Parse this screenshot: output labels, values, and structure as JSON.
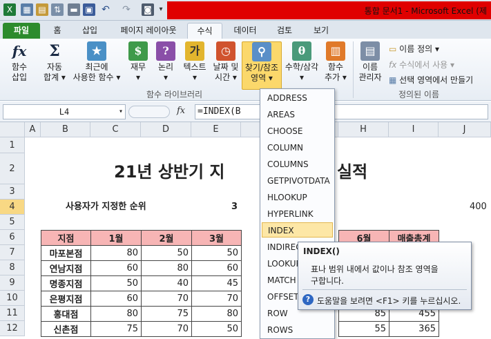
{
  "window": {
    "title": "통합 문서1 - Microsoft Excel (제"
  },
  "tabs": [
    "파일",
    "홈",
    "삽입",
    "페이지 레이아웃",
    "수식",
    "데이터",
    "검토",
    "보기"
  ],
  "ribbon": {
    "fx": {
      "symbol": "fx",
      "l1": "함수",
      "l2": "삽입"
    },
    "sum": {
      "symbol": "Σ",
      "l1": "자동",
      "l2": "합계 ▾"
    },
    "recent": {
      "l1": "최근에",
      "l2": "사용한 함수 ▾"
    },
    "finance": {
      "l1": "재무",
      "l2": "▾"
    },
    "logic": {
      "l1": "논리",
      "l2": "▾"
    },
    "text": {
      "l1": "텍스트",
      "l2": "▾"
    },
    "date": {
      "l1": "날짜 및",
      "l2": "시간 ▾"
    },
    "lookup": {
      "l1": "찾기/참조",
      "l2": "영역 ▾"
    },
    "math": {
      "l1": "수학/삼각",
      "l2": "▾"
    },
    "more": {
      "l1": "함수",
      "l2": "추가 ▾"
    },
    "group_library": "함수 라이브러리",
    "name_manager": {
      "l1": "이름",
      "l2": "관리자"
    },
    "define_name": "이름 정의 ▾",
    "use_in_formula": "수식에서 사용 ▾",
    "create_from_sel": "선택 영역에서 만들기",
    "group_names": "정의된 이름"
  },
  "formula_bar": {
    "name_box": "L4",
    "fx": "fx",
    "formula": "=INDEX(B"
  },
  "columns": [
    "A",
    "B",
    "C",
    "D",
    "E",
    "H",
    "I",
    "J"
  ],
  "rows": [
    "1",
    "2",
    "3",
    "4",
    "5",
    "6",
    "7",
    "8",
    "9",
    "10",
    "11",
    "12"
  ],
  "sheet": {
    "title_left": "21년 상반기 지",
    "title_right": "실적",
    "user_rank_label": "사용자가 지정한 순위",
    "user_rank_value": "3",
    "j4_value": "400",
    "headers": [
      "지점",
      "1월",
      "2월",
      "3월",
      "6월",
      "매출총계"
    ],
    "data": [
      [
        "마포본점",
        "80",
        "50",
        "50",
        "",
        ""
      ],
      [
        "연남지점",
        "60",
        "80",
        "60",
        "",
        ""
      ],
      [
        "명종지점",
        "50",
        "40",
        "45",
        "",
        ""
      ],
      [
        "은평지점",
        "60",
        "70",
        "70",
        "",
        ""
      ],
      [
        "홍대점",
        "80",
        "75",
        "80",
        "85",
        "455"
      ],
      [
        "신촌점",
        "75",
        "70",
        "50",
        "55",
        "365"
      ]
    ]
  },
  "dropdown": [
    "ADDRESS",
    "AREAS",
    "CHOOSE",
    "COLUMN",
    "COLUMNS",
    "GETPIVOTDATA",
    "HLOOKUP",
    "HYPERLINK",
    "INDEX",
    "INDIRECT",
    "LOOKUP",
    "MATCH",
    "OFFSET",
    "ROW",
    "ROWS"
  ],
  "tooltip": {
    "title": "INDEX()",
    "desc1": "표나 범위 내에서 값이나 참조 영역을",
    "desc2": "구합니다.",
    "help": "도움말을 보려면 <F1> 키를 누르십시오."
  }
}
